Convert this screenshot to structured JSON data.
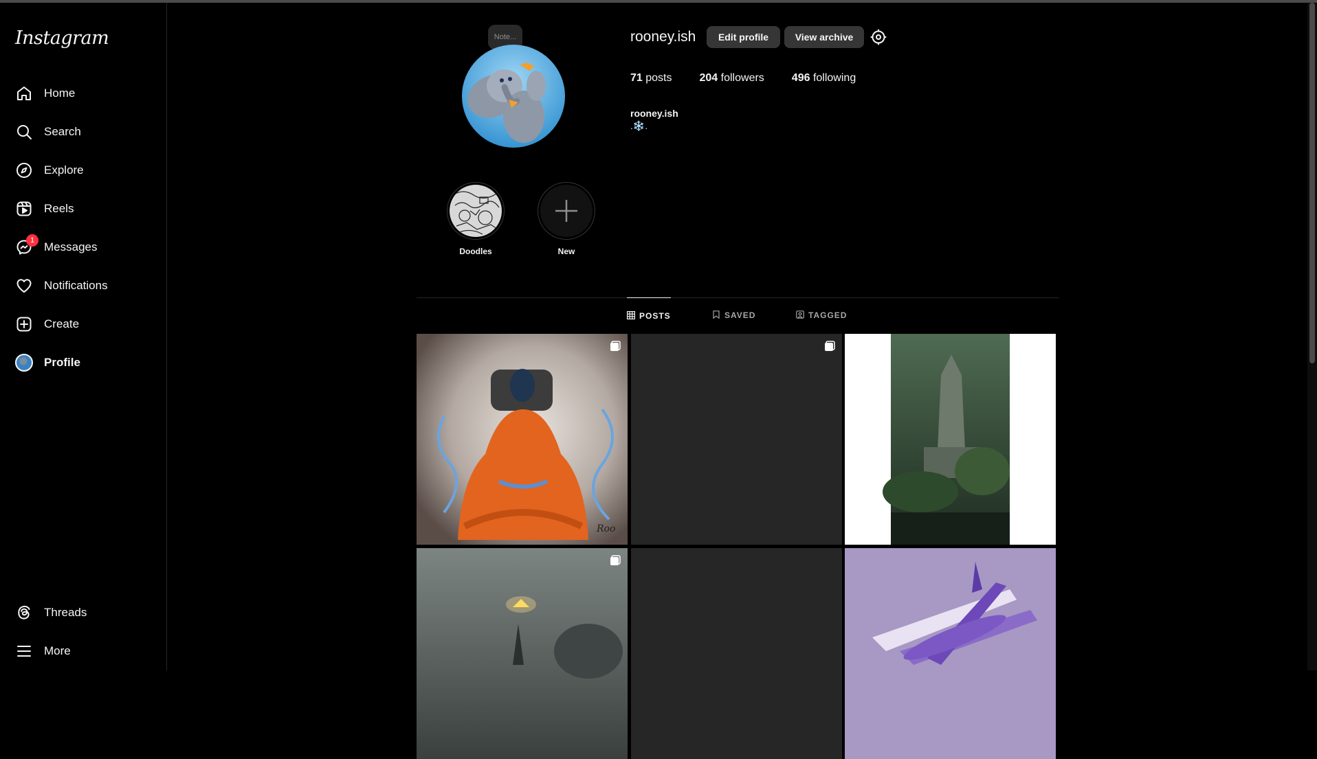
{
  "app": {
    "logo": "Instagram"
  },
  "sidebar": {
    "items": [
      {
        "label": "Home",
        "icon": "home-icon"
      },
      {
        "label": "Search",
        "icon": "search-icon"
      },
      {
        "label": "Explore",
        "icon": "compass-icon"
      },
      {
        "label": "Reels",
        "icon": "reels-icon"
      },
      {
        "label": "Messages",
        "icon": "messenger-icon",
        "badge": "1"
      },
      {
        "label": "Notifications",
        "icon": "heart-icon"
      },
      {
        "label": "Create",
        "icon": "plus-square-icon"
      },
      {
        "label": "Profile",
        "icon": "avatar"
      }
    ],
    "bottom": [
      {
        "label": "Threads",
        "icon": "threads-icon"
      },
      {
        "label": "More",
        "icon": "menu-icon"
      }
    ]
  },
  "profile": {
    "note": "Note...",
    "username": "rooney.ish",
    "edit_label": "Edit profile",
    "archive_label": "View archive",
    "stats": {
      "posts_count": "71",
      "posts_label": "posts",
      "followers_count": "204",
      "followers_label": "followers",
      "following_count": "496",
      "following_label": "following"
    },
    "bio_name": "rooney.ish",
    "bio_text": ".❄️."
  },
  "highlights": [
    {
      "label": "Doodles"
    },
    {
      "label": "New"
    }
  ],
  "tabs": [
    {
      "label": "POSTS",
      "icon": "grid-icon",
      "active": true
    },
    {
      "label": "SAVED",
      "icon": "bookmark-icon",
      "active": false
    },
    {
      "label": "TAGGED",
      "icon": "tag-icon",
      "active": false
    }
  ],
  "colors": {
    "background": "#000000",
    "button": "#363636",
    "badge": "#ff3040"
  }
}
